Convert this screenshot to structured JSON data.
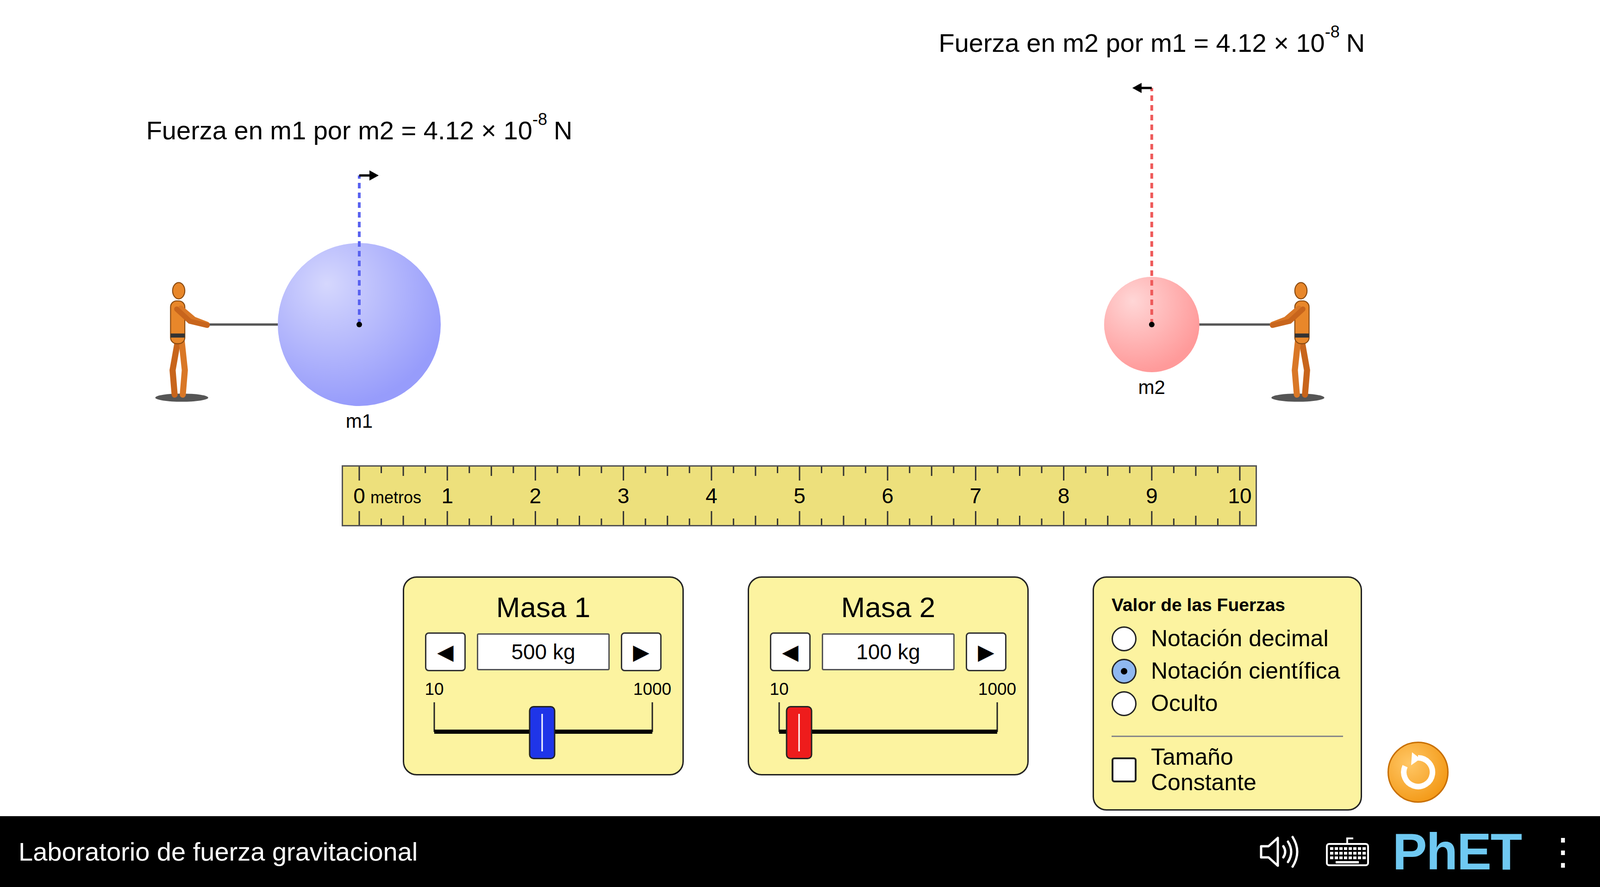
{
  "title": "Laboratorio de fuerza gravitacional",
  "forces": [
    {
      "text": "Fuerza en m1 por m2 = 4.12 × 10",
      "exponent": "-8",
      "unit": "N"
    },
    {
      "text": "Fuerza en m2 por m1 = 4.12 × 10",
      "exponent": "-8",
      "unit": "N"
    }
  ],
  "masses": [
    {
      "label": "m1",
      "position_m": 0,
      "color": "#979cfb",
      "force_color": "#5a63f0",
      "panel_title": "Masa 1",
      "value": "500 kg",
      "min": "10",
      "max": "1000",
      "level": 0.495,
      "thumb_color": "#1f35e8",
      "decrease": "◀",
      "increase": "▶"
    },
    {
      "label": "m2",
      "position_m": 9,
      "color": "#ff9a9a",
      "force_color": "#ee5a5a",
      "panel_title": "Masa 2",
      "value": "100 kg",
      "min": "10",
      "max": "1000",
      "level": 0.091,
      "thumb_color": "#ee1c1c",
      "decrease": "◀",
      "increase": "▶"
    }
  ],
  "ruler": {
    "unit": "metros",
    "ticks": [
      "0",
      "1",
      "2",
      "3",
      "4",
      "5",
      "6",
      "7",
      "8",
      "9",
      "10"
    ]
  },
  "force_values": {
    "title": "Valor de las Fuerzas",
    "options": [
      {
        "label": "Notación decimal",
        "selected": false
      },
      {
        "label": "Notación científica",
        "selected": true
      },
      {
        "label": "Oculto",
        "selected": false
      }
    ],
    "constant_size": {
      "label": "Tamaño Constante",
      "checked": false
    }
  },
  "footer": {
    "logo": "PhET",
    "menu": "⋮"
  }
}
